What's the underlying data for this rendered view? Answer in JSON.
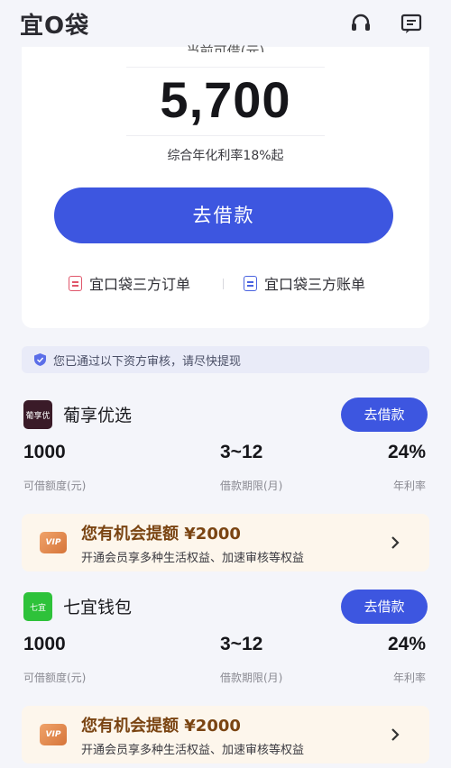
{
  "header": {
    "logo": "宜O袋",
    "icons": [
      "headset-icon",
      "message-icon"
    ]
  },
  "top": {
    "amount_label": "当前可借(元)",
    "amount": "5,700",
    "rate_text": "综合年化利率18%起",
    "borrow_button": "去借款",
    "link_orders": "宜口袋三方订单",
    "link_bills": "宜口袋三方账单"
  },
  "notice": "您已通过以下资方审核，请尽快提现",
  "lenders": [
    {
      "logo_text": "葡享优",
      "name": "葡享优选",
      "apply": "去借款",
      "amount": "1000",
      "amount_label": "可借额度(元)",
      "term": "3~12",
      "term_label": "借款期限(月)",
      "rate": "24%",
      "rate_label": "年利率",
      "vip_badge": "VIP",
      "vip_title": "您有机会提额 ¥2000",
      "vip_sub": "开通会员享多种生活权益、加速审核等权益"
    },
    {
      "logo_text": "七宜",
      "name": "七宜钱包",
      "apply": "去借款",
      "amount": "1000",
      "amount_label": "可借额度(元)",
      "term": "3~12",
      "term_label": "借款期限(月)",
      "rate": "24%",
      "rate_label": "年利率",
      "vip_badge": "VIP",
      "vip_title": "您有机会提额 ¥2000",
      "vip_sub": "开通会员享多种生活权益、加速审核等权益"
    }
  ],
  "colors": {
    "primary": "#3d56e0",
    "vip_bg": "#fdf6ec",
    "vip_title": "#7a4412"
  }
}
